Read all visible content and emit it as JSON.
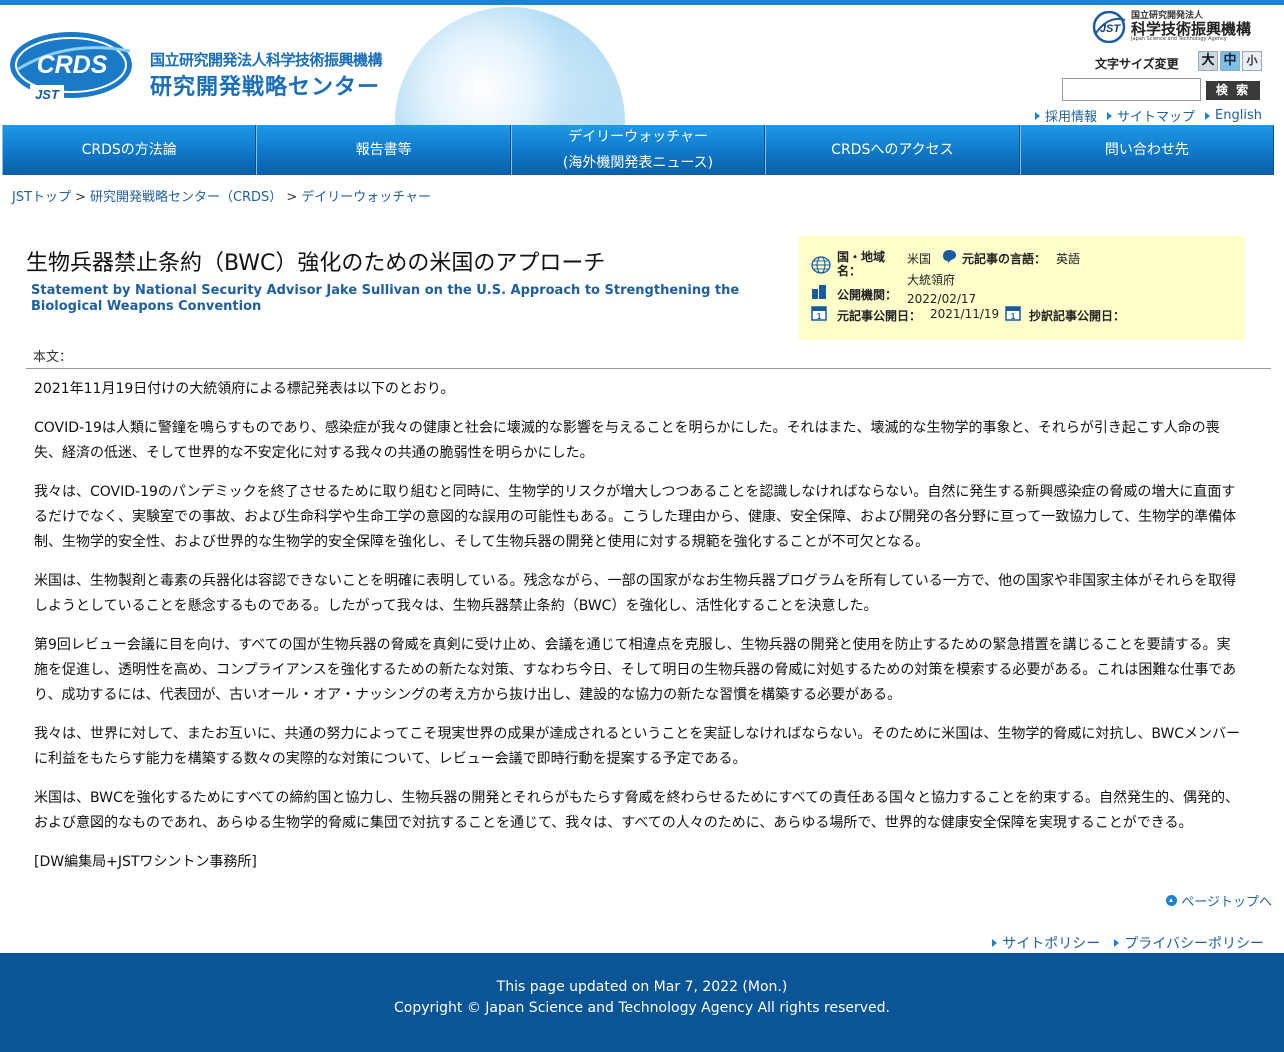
{
  "header": {
    "logo_text": "CRDS",
    "logo_sub": "JST",
    "org_small": "国立研究開発法人科学技術振興機構",
    "center_name": "研究開発戦略センター",
    "jst_logo_mark": "JST",
    "jst_org_small": "国立研究開発法人",
    "jst_org_name": "科学技術振興機構",
    "jst_org_en": "Japan Science and Technology Agency",
    "font_size_label": "文字サイズ変更",
    "font_size_large": "大",
    "font_size_mid": "中",
    "font_size_small": "小",
    "search_value": "",
    "search_button": "検 索",
    "util_links": [
      "採用情報",
      "サイトマップ",
      "English"
    ]
  },
  "nav": {
    "items": [
      {
        "label": "CRDSの方法論"
      },
      {
        "label": "報告書等"
      },
      {
        "label": "デイリーウォッチャー",
        "label2": "(海外機関発表ニュース)"
      },
      {
        "label": "CRDSへのアクセス"
      },
      {
        "label": "問い合わせ先"
      }
    ]
  },
  "breadcrumb": {
    "items": [
      "JSTトップ",
      "研究開発戦略センター（CRDS）",
      "デイリーウォッチャー"
    ],
    "separator": ">"
  },
  "article": {
    "title": "生物兵器禁止条約（BWC）強化のための米国のアプローチ",
    "subtitle": "Statement by National Security Advisor Jake Sullivan on the U.S. Approach to Strengthening the Biological Weapons Convention",
    "info": {
      "region_label": "国・地域名：",
      "region_value": "米国",
      "language_label": "元記事の言語：",
      "language_value": "英語",
      "agency_label": "公開機関：",
      "agency_value": "大統領府",
      "translation_date_value": "2022/02/17",
      "original_date_label": "元記事公開日：",
      "original_date_value": "2021/11/19",
      "translation_label": "抄訳記事公開日："
    },
    "body_label": "本文：",
    "paragraphs": [
      "2021年11月19日付けの大統領府による標記発表は以下のとおり。",
      "COVID-19は人類に警鐘を鳴らすものであり、感染症が我々の健康と社会に壊滅的な影響を与えることを明らかにした。それはまた、壊滅的な生物学的事象と、それらが引き起こす人命の喪失、経済の低迷、そして世界的な不安定化に対する我々の共通の脆弱性を明らかにした。",
      "我々は、COVID-19のパンデミックを終了させるために取り組むと同時に、生物学的リスクが増大しつつあることを認識しなければならない。自然に発生する新興感染症の脅威の増大に直面するだけでなく、実験室での事故、および生命科学や生命工学の意図的な誤用の可能性もある。こうした理由から、健康、安全保障、および開発の各分野に亘って一致協力して、生物学的準備体制、生物学的安全性、および世界的な生物学的安全保障を強化し、そして生物兵器の開発と使用に対する規範を強化することが不可欠となる。",
      "米国は、生物製剤と毒素の兵器化は容認できないことを明確に表明している。残念ながら、一部の国家がなお生物兵器プログラムを所有している一方で、他の国家や非国家主体がそれらを取得しようとしていることを懸念するものである。したがって我々は、生物兵器禁止条約（BWC）を強化し、活性化することを決意した。",
      "第9回レビュー会議に目を向け、すべての国が生物兵器の脅威を真剣に受け止め、会議を通じて相違点を克服し、生物兵器の開発と使用を防止するための緊急措置を講じることを要請する。実施を促進し、透明性を高め、コンプライアンスを強化するための新たな対策、すなわち今日、そして明日の生物兵器の脅威に対処するための対策を模索する必要がある。これは困難な仕事であり、成功するには、代表団が、古いオール・オア・ナッシングの考え方から抜け出し、建設的な協力の新たな習慣を構築する必要がある。",
      "我々は、世界に対して、またお互いに、共通の努力によってこそ現実世界の成果が達成されるということを実証しなければならない。そのために米国は、生物学的脅威に対抗し、BWCメンバーに利益をもたらす能力を構築する数々の実際的な対策について、レビュー会議で即時行動を提案する予定である。",
      "米国は、BWCを強化するためにすべての締約国と協力し、生物兵器の開発とそれらがもたらす脅威を終わらせるためにすべての責任ある国々と協力することを約束する。自然発生的、偶発的、および意図的なものであれ、あらゆる生物学的脅威に集団で対抗することを通じて、我々は、すべての人々のために、あらゆる場所で、世界的な健康安全保障を実現することができる。",
      "[DW編集局+JSTワシントン事務所]"
    ]
  },
  "page_top": "ページトップへ",
  "footer_links": [
    "サイトポリシー",
    "プライバシーポリシー"
  ],
  "footer": {
    "updated": "This page updated on Mar 7, 2022 (Mon.)",
    "copyright": "Copyright © Japan Science and Technology Agency All rights reserved."
  },
  "colors": {
    "accent": "#1a82d0",
    "nav_blue": "#0f78c7",
    "link": "#1f5f9e",
    "info_bg": "#ffffcc",
    "footer_bg": "#0a5596"
  }
}
